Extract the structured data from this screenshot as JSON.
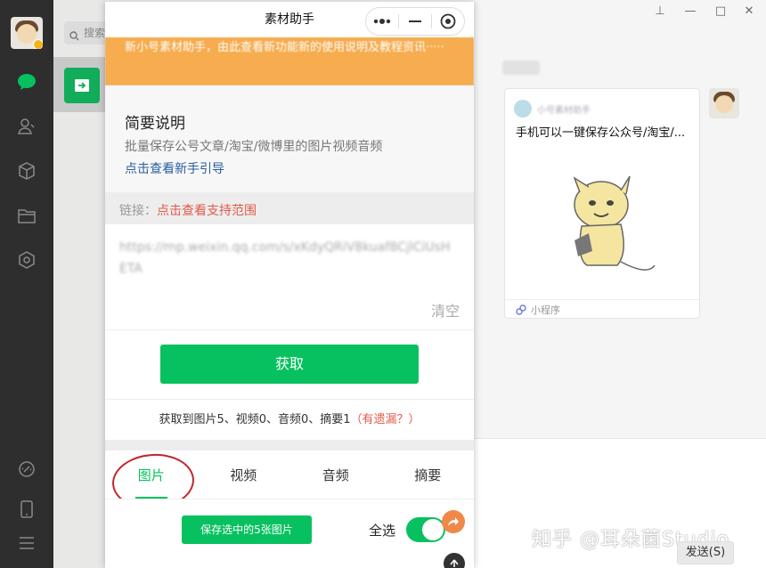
{
  "wechat": {
    "search_placeholder": "搜索",
    "send_button": "发送(S)"
  },
  "mini_program": {
    "title": "素材助手",
    "banner_text": "新小号素材助手，由此查看新功能新的使用说明及教程资讯·····",
    "intro": {
      "heading": "简要说明",
      "description": "批量保存公号文章/淘宝/微博里的图片视频音频",
      "guide_link": "点击查看新手引导"
    },
    "link_row": {
      "label": "链接：",
      "scope_link": "点击查看支持范围"
    },
    "input": {
      "value": "https://mp.weixin.qq.com/s/xKdyQRiV8kuaf8CjlCiUsHETA",
      "clear_label": "清空"
    },
    "fetch_button": "获取",
    "result": {
      "text": "获取到图片5、视频0、音频0、摘要1",
      "missing_link": "（有遗漏？）"
    },
    "tabs": [
      {
        "label": "图片",
        "active": true
      },
      {
        "label": "视频",
        "active": false
      },
      {
        "label": "音频",
        "active": false
      },
      {
        "label": "摘要",
        "active": false
      }
    ],
    "save_button": "保存选中的5张图片",
    "select_all_label": "全选",
    "select_all_on": true
  },
  "chat_card": {
    "source": "小号素材助手",
    "title": "手机可以一键保存公众号/淘宝/...",
    "footer_label": "小程序"
  },
  "watermark": "知乎 @耳朵菌Studio",
  "colors": {
    "accent": "#07c160",
    "banner": "#f6ac4f",
    "link_blue": "#2a5d9f",
    "alert_red": "#e05a4a",
    "rail": "#2e2e2e"
  }
}
